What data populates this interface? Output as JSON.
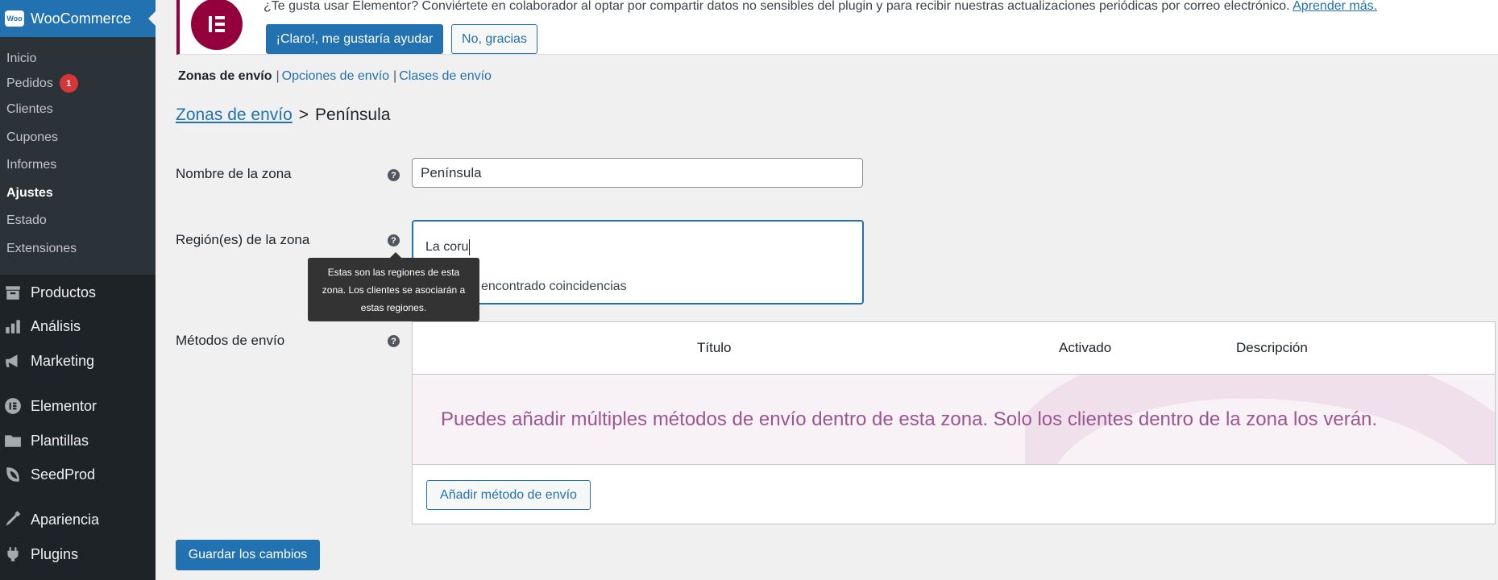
{
  "sidebar": {
    "woocommerce": {
      "label": "WooCommerce",
      "logo_text": "Woo"
    },
    "submenu": [
      {
        "label": "Inicio"
      },
      {
        "label": "Pedidos",
        "badge": "1"
      },
      {
        "label": "Clientes"
      },
      {
        "label": "Cupones"
      },
      {
        "label": "Informes"
      },
      {
        "label": "Ajustes",
        "current": true
      },
      {
        "label": "Estado"
      },
      {
        "label": "Extensiones"
      }
    ],
    "menu": [
      {
        "label": "Productos",
        "icon": "archive-icon"
      },
      {
        "label": "Análisis",
        "icon": "bar-chart-icon"
      },
      {
        "label": "Marketing",
        "icon": "megaphone-icon"
      },
      {
        "label": "Elementor",
        "icon": "elementor-icon"
      },
      {
        "label": "Plantillas",
        "icon": "folder-icon"
      },
      {
        "label": "SeedProd",
        "icon": "seedprod-icon"
      },
      {
        "label": "Apariencia",
        "icon": "paintbrush-icon"
      },
      {
        "label": "Plugins",
        "icon": "plug-icon"
      }
    ]
  },
  "notice": {
    "text": "¿Te gusta usar Elementor? Conviértete en colaborador al optar por compartir datos no sensibles del plugin y para recibir nuestras actualizaciones periódicas por correo electrónico.",
    "link": "Aprender más.",
    "accept_label": "¡Claro!, me gustaría ayudar",
    "decline_label": "No, gracias",
    "brand_color": "#93003c"
  },
  "subnav": {
    "current": "Zonas de envío",
    "links": [
      "Opciones de envío",
      "Clases de envío"
    ],
    "separator": "|"
  },
  "breadcrumb": {
    "parent": "Zonas de envío",
    "separator": ">",
    "current": "Península"
  },
  "form": {
    "zone_name": {
      "label": "Nombre de la zona",
      "value": "Península"
    },
    "zone_regions": {
      "label": "Región(es) de la zona",
      "value": "La coru",
      "no_results": "encontrado coincidencias",
      "tooltip": [
        "Estas son las regiones de esta",
        "zona. Los clientes se asociarán a",
        "estas regiones."
      ]
    },
    "methods": {
      "label": "Métodos de envío",
      "columns": [
        "Título",
        "Activado",
        "Descripción"
      ],
      "blank_message": "Puedes añadir múltiples métodos de envío dentro de esta zona. Solo los clientes dentro de la zona los verán.",
      "add_label": "Añadir método de envío"
    },
    "help_glyph": "?",
    "save_label": "Guardar los cambios"
  },
  "colors": {
    "accent": "#2271b1",
    "sidebar_bg": "#1d2327",
    "badge": "#d63638",
    "blank_text": "#9d5590"
  }
}
